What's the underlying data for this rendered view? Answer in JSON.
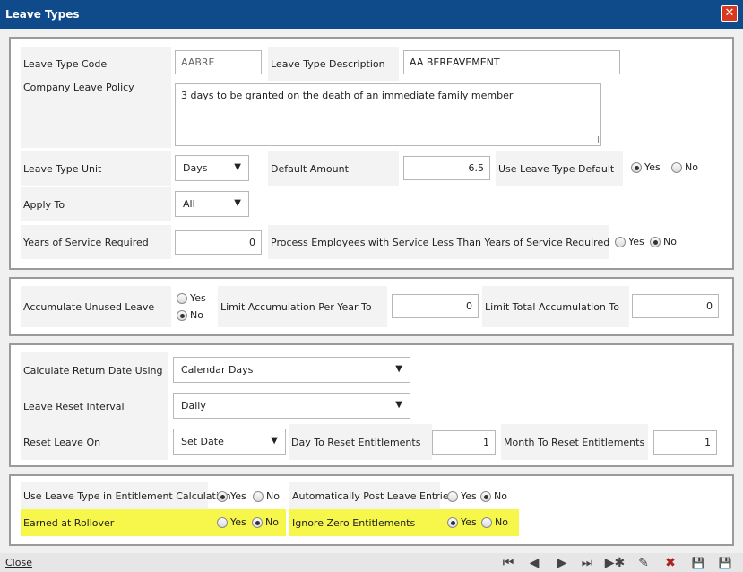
{
  "window": {
    "title": "Leave Types",
    "close_glyph": "✕"
  },
  "general": {
    "leave_type_code_label": "Leave Type Code",
    "leave_type_code_value": "AABRE",
    "leave_type_description_label": "Leave Type Description",
    "leave_type_description_value": "AA BEREAVEMENT",
    "company_leave_policy_label": "Company Leave Policy",
    "company_leave_policy_value": "3 days to be granted on the death of an immediate family member",
    "leave_type_unit_label": "Leave Type Unit",
    "leave_type_unit_value": "Days",
    "default_amount_label": "Default Amount",
    "default_amount_value": "6.5",
    "use_leave_type_default_label": "Use Leave Type Default",
    "apply_to_label": "Apply To",
    "apply_to_value": "All",
    "years_of_service_label": "Years of Service Required",
    "years_of_service_value": "0",
    "process_employees_label": "Process Employees with Service Less Than Years of Service Required"
  },
  "accumulation": {
    "accumulate_unused_label": "Accumulate Unused Leave",
    "limit_per_year_label": "Limit Accumulation Per Year To",
    "limit_per_year_value": "0",
    "limit_total_label": "Limit Total Accumulation To",
    "limit_total_value": "0"
  },
  "reset": {
    "calculate_return_label": "Calculate Return Date Using",
    "calculate_return_value": "Calendar Days",
    "reset_interval_label": "Leave Reset Interval",
    "reset_interval_value": "Daily",
    "reset_on_label": "Reset Leave On",
    "reset_on_value": "Set Date",
    "day_to_reset_label": "Day To Reset Entitlements",
    "day_to_reset_value": "1",
    "month_to_reset_label": "Month To Reset Entitlements",
    "month_to_reset_value": "1"
  },
  "entitlement": {
    "use_in_calc_label": "Use Leave Type in Entitlement Calculation",
    "auto_post_label": "Automatically Post Leave Entries",
    "earned_rollover_label": "Earned at Rollover",
    "ignore_zero_label": "Ignore Zero Entitlements"
  },
  "radio": {
    "yes": "Yes",
    "no": "No"
  },
  "footer": {
    "close_label": "Close",
    "first_glyph": "⏮",
    "prev_glyph": "◀",
    "next_glyph": "▶",
    "last_glyph": "⏭",
    "new_glyph": "▶✱",
    "undo_glyph": "✎",
    "delete_glyph": "✖",
    "save_glyph": "💾",
    "save_edit_glyph": "💾"
  },
  "colors": {
    "titlebar": "#0f4a8a",
    "highlight": "#f7f64a",
    "close_button": "#d9381e"
  },
  "icons": [
    "close-icon",
    "first-record-icon",
    "previous-record-icon",
    "next-record-icon",
    "last-record-icon",
    "new-record-icon",
    "cancel-edit-icon",
    "delete-icon",
    "save-icon",
    "save-edit-icon"
  ]
}
